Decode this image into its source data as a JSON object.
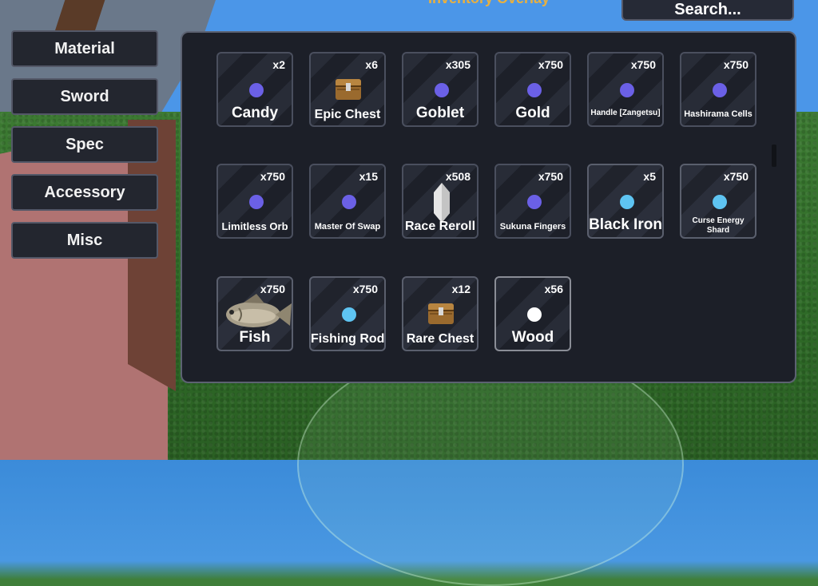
{
  "header": {
    "title_partial": "Inventory Overlay",
    "search_label": "Search..."
  },
  "categories": [
    {
      "label": "Material"
    },
    {
      "label": "Sword"
    },
    {
      "label": "Spec"
    },
    {
      "label": "Accessory"
    },
    {
      "label": "Misc"
    }
  ],
  "items": [
    {
      "name": "Candy",
      "count": "x2",
      "icon": "purple-orb-icon"
    },
    {
      "name": "Epic Chest",
      "count": "x6",
      "icon": "chest-icon"
    },
    {
      "name": "Goblet",
      "count": "x305",
      "icon": "purple-orb-icon"
    },
    {
      "name": "Gold",
      "count": "x750",
      "icon": "purple-orb-icon"
    },
    {
      "name": "Handle [Zangetsu]",
      "count": "x750",
      "icon": "purple-orb-icon"
    },
    {
      "name": "Hashirama Cells",
      "count": "x750",
      "icon": "purple-orb-icon"
    },
    {
      "name": "Limitless Orb",
      "count": "x750",
      "icon": "purple-orb-icon"
    },
    {
      "name": "Master Of Swap",
      "count": "x15",
      "icon": "purple-orb-icon"
    },
    {
      "name": "Race Reroll",
      "count": "x508",
      "icon": "crystal-icon"
    },
    {
      "name": "Sukuna Fingers",
      "count": "x750",
      "icon": "purple-orb-icon"
    },
    {
      "name": "Black Iron",
      "count": "x5",
      "icon": "blue-orb-icon"
    },
    {
      "name": "Curse Energy Shard",
      "count": "x750",
      "icon": "blue-orb-icon"
    },
    {
      "name": "Fish",
      "count": "x750",
      "icon": "fish-icon"
    },
    {
      "name": "Fishing Rod",
      "count": "x750",
      "icon": "blue-orb-icon"
    },
    {
      "name": "Rare Chest",
      "count": "x12",
      "icon": "chest-icon"
    },
    {
      "name": "Wood",
      "count": "x56",
      "icon": "white-orb-icon"
    }
  ]
}
